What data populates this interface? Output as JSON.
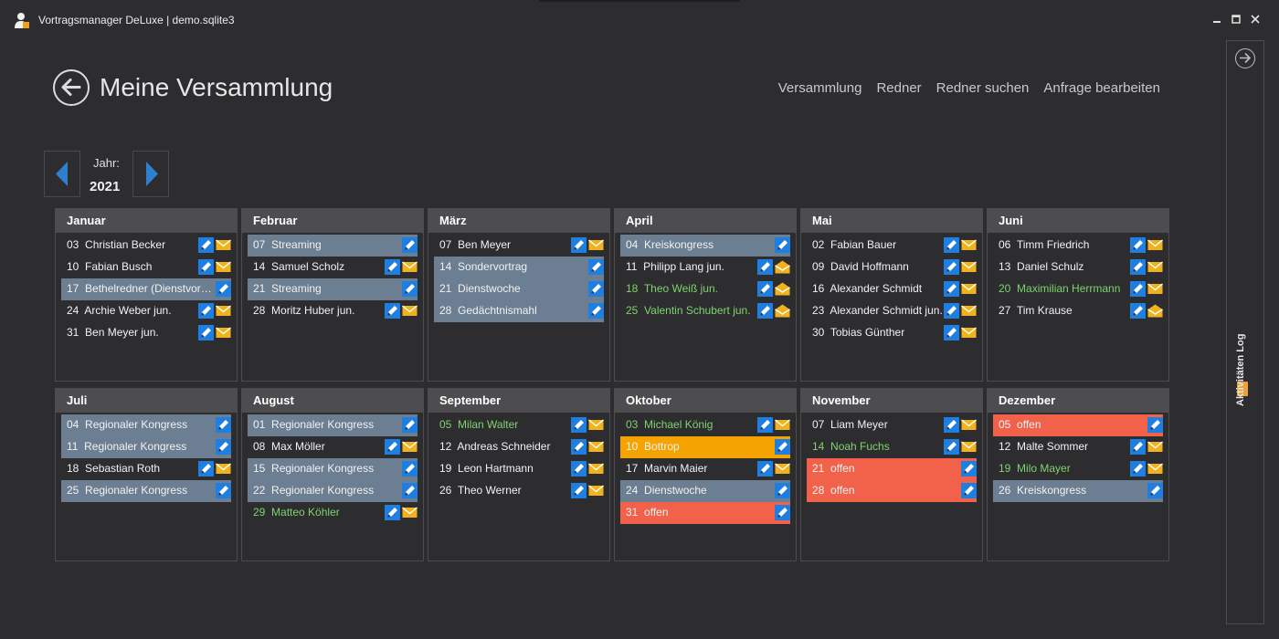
{
  "window": {
    "title": "Vortragsmanager DeLuxe | demo.sqlite3"
  },
  "header": {
    "title": "Meine Versammlung",
    "nav": [
      "Versammlung",
      "Redner",
      "Redner suchen",
      "Anfrage bearbeiten"
    ]
  },
  "year": {
    "label": "Jahr:",
    "value": "2021"
  },
  "side_panel": {
    "label": "Aktivitäten Log"
  },
  "colors": {
    "highlight_blue": "#6c7e92",
    "highlight_orange": "#f5a300",
    "highlight_red": "#f2624b",
    "green_text": "#7fd36f",
    "mail_icon": "#f0b21e",
    "edit_icon": "#1e7fe0"
  },
  "months": [
    {
      "name": "Januar",
      "rows": [
        {
          "day": "03",
          "text": "Christian Becker"
        },
        {
          "day": "10",
          "text": "Fabian Busch"
        },
        {
          "day": "17",
          "text": "Bethelredner (Dienstvortr…"
        },
        {
          "day": "24",
          "text": "Archie Weber jun."
        },
        {
          "day": "31",
          "text": "Ben Meyer jun."
        }
      ]
    },
    {
      "name": "Februar",
      "rows": [
        {
          "day": "07",
          "text": "Streaming"
        },
        {
          "day": "14",
          "text": "Samuel Scholz"
        },
        {
          "day": "21",
          "text": "Streaming"
        },
        {
          "day": "28",
          "text": "Moritz Huber jun."
        }
      ]
    },
    {
      "name": "März",
      "rows": [
        {
          "day": "07",
          "text": "Ben Meyer"
        },
        {
          "day": "14",
          "text": "Sondervortrag"
        },
        {
          "day": "21",
          "text": "Dienstwoche"
        },
        {
          "day": "28",
          "text": "Gedächtnismahl"
        }
      ]
    },
    {
      "name": "April",
      "rows": [
        {
          "day": "04",
          "text": "Kreiskongress"
        },
        {
          "day": "11",
          "text": "Philipp Lang jun."
        },
        {
          "day": "18",
          "text": "Theo Weiß jun."
        },
        {
          "day": "25",
          "text": "Valentin Schubert jun."
        }
      ]
    },
    {
      "name": "Mai",
      "rows": [
        {
          "day": "02",
          "text": "Fabian Bauer"
        },
        {
          "day": "09",
          "text": "David Hoffmann"
        },
        {
          "day": "16",
          "text": "Alexander Schmidt"
        },
        {
          "day": "23",
          "text": "Alexander Schmidt jun."
        },
        {
          "day": "30",
          "text": "Tobias Günther"
        }
      ]
    },
    {
      "name": "Juni",
      "rows": [
        {
          "day": "06",
          "text": "Timm Friedrich"
        },
        {
          "day": "13",
          "text": "Daniel Schulz"
        },
        {
          "day": "20",
          "text": "Maximilian Herrmann"
        },
        {
          "day": "27",
          "text": "Tim Krause"
        }
      ]
    },
    {
      "name": "Juli",
      "rows": [
        {
          "day": "04",
          "text": "Regionaler Kongress"
        },
        {
          "day": "11",
          "text": "Regionaler Kongress"
        },
        {
          "day": "18",
          "text": "Sebastian Roth"
        },
        {
          "day": "25",
          "text": "Regionaler Kongress"
        }
      ]
    },
    {
      "name": "August",
      "rows": [
        {
          "day": "01",
          "text": "Regionaler Kongress"
        },
        {
          "day": "08",
          "text": "Max Möller"
        },
        {
          "day": "15",
          "text": "Regionaler Kongress"
        },
        {
          "day": "22",
          "text": "Regionaler Kongress"
        },
        {
          "day": "29",
          "text": "Matteo Köhler"
        }
      ]
    },
    {
      "name": "September",
      "rows": [
        {
          "day": "05",
          "text": "Milan Walter"
        },
        {
          "day": "12",
          "text": "Andreas Schneider"
        },
        {
          "day": "19",
          "text": "Leon Hartmann"
        },
        {
          "day": "26",
          "text": "Theo Werner"
        }
      ]
    },
    {
      "name": "Oktober",
      "rows": [
        {
          "day": "03",
          "text": "Michael König"
        },
        {
          "day": "10",
          "text": "Bottrop"
        },
        {
          "day": "17",
          "text": "Marvin Maier"
        },
        {
          "day": "24",
          "text": "Dienstwoche"
        },
        {
          "day": "31",
          "text": "offen"
        }
      ]
    },
    {
      "name": "November",
      "rows": [
        {
          "day": "07",
          "text": "Liam Meyer"
        },
        {
          "day": "14",
          "text": "Noah Fuchs"
        },
        {
          "day": "21",
          "text": "offen"
        },
        {
          "day": "28",
          "text": "offen"
        }
      ]
    },
    {
      "name": "Dezember",
      "rows": [
        {
          "day": "05",
          "text": "offen"
        },
        {
          "day": "12",
          "text": "Malte Sommer"
        },
        {
          "day": "19",
          "text": "Milo Mayer"
        },
        {
          "day": "26",
          "text": "Kreiskongress"
        }
      ]
    }
  ]
}
